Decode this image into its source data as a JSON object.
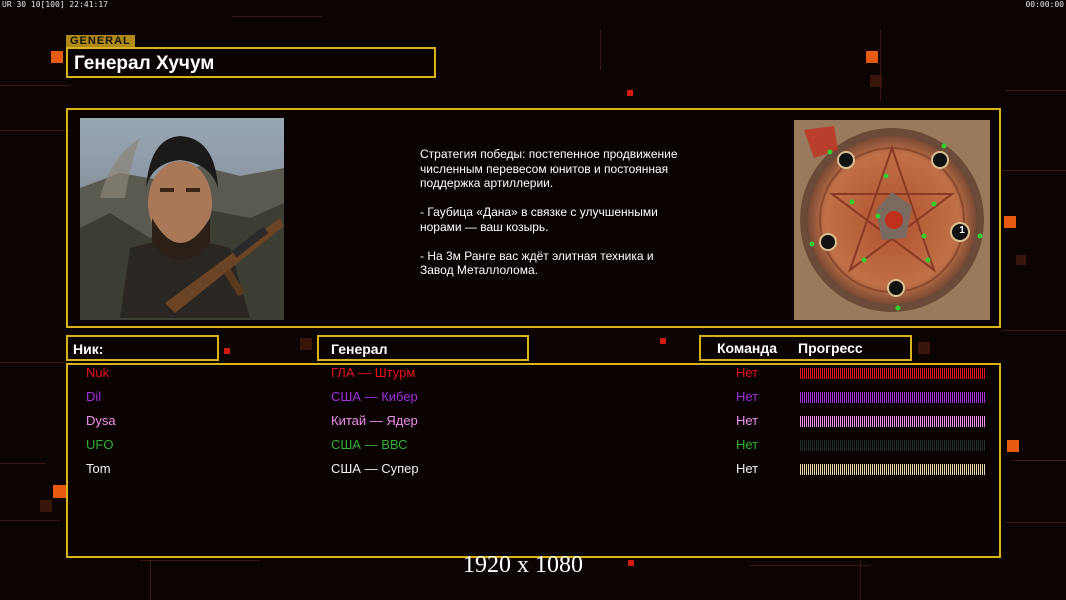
{
  "hud": {
    "top_left": "UR 30 10[100] 22:41:17",
    "top_right": "00:00:00"
  },
  "general_tag": "GENERAL",
  "title": "Генерал Хучум",
  "description": [
    "Стратегия победы: постепенное продвижение численным перевесом юнитов и постоянная поддержка артиллерии.",
    "- Гаубица «Дана» в связке с улучшенными норами — ваш козырь.",
    "- На 3м Ранге вас ждёт элитная техника и Завод Металлолома."
  ],
  "minimap": {
    "slot_label": "1"
  },
  "headers": {
    "nick": "Ник:",
    "general": "Генерал",
    "team": "Команда",
    "progress": "Прогресс"
  },
  "players": [
    {
      "nick": "Nuk",
      "general": "ГЛА — Штурм",
      "team": "Нет",
      "color": "#e8101c"
    },
    {
      "nick": "Dil",
      "general": "США — Кибер",
      "team": "Нет",
      "color": "#a030e0"
    },
    {
      "nick": "Dysa",
      "general": "Китай — Ядер",
      "team": "Нет",
      "color": "#f090f0"
    },
    {
      "nick": "UFO",
      "general": "США — ВВС",
      "team": "Нет",
      "color": "#30b030"
    },
    {
      "nick": "Tom",
      "general": "США — Супер",
      "team": "Нет",
      "color": "#f0f0f0"
    }
  ],
  "progress_fill": [
    1,
    1,
    1,
    0,
    1
  ],
  "resolution": "1920 x 1080",
  "colors": {
    "frame": "#d8b41a",
    "accent_orange": "#e85a10",
    "background": "#0c0403"
  }
}
